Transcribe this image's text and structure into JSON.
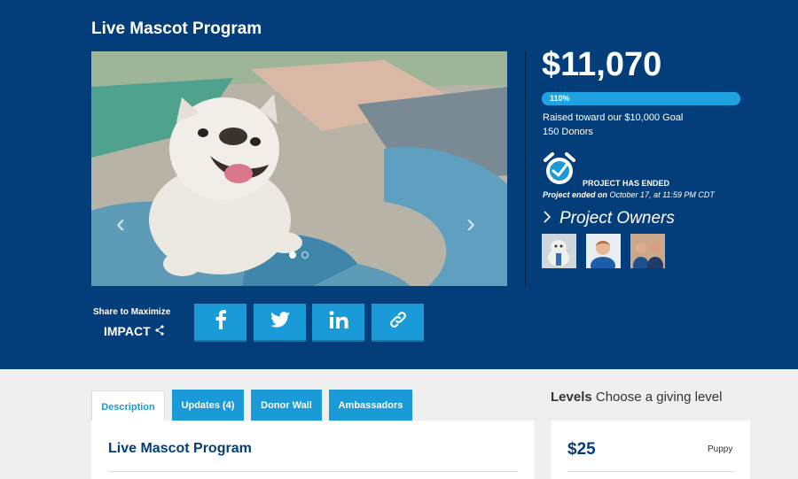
{
  "page": {
    "title": "Live Mascot Program"
  },
  "carousel": {
    "slide_count": 2,
    "active_slide": 1
  },
  "stats": {
    "amount": "$11,070",
    "progress_label": "110%",
    "progress_percent": 110,
    "raised_text": "Raised toward our $10,000 Goal",
    "donors_text": "150 Donors"
  },
  "status": {
    "ended_title": "PROJECT HAS ENDED",
    "ended_prefix": "Project ended on",
    "ended_date": "October 17, at 11:59 PM CDT"
  },
  "owners": {
    "heading": "Project Owners",
    "items": [
      {
        "icon": "owner-photo-bulldog"
      },
      {
        "icon": "owner-photo-woman"
      },
      {
        "icon": "owner-photo-couple"
      }
    ]
  },
  "share": {
    "label": "Share to Maximize",
    "impact": "IMPACT",
    "buttons": [
      {
        "icon": "facebook-icon"
      },
      {
        "icon": "twitter-icon"
      },
      {
        "icon": "linkedin-icon"
      },
      {
        "icon": "link-icon"
      }
    ]
  },
  "tabs": [
    {
      "label": "Description",
      "active": true
    },
    {
      "label": "Updates (4)",
      "active": false
    },
    {
      "label": "Donor Wall",
      "active": false
    },
    {
      "label": "Ambassadors",
      "active": false
    }
  ],
  "description": {
    "title": "Live Mascot Program"
  },
  "levels": {
    "heading_bold": "Levels",
    "heading_rest": "Choose a giving level",
    "items": [
      {
        "amount": "$25",
        "name": "Puppy"
      }
    ]
  },
  "colors": {
    "brand_navy": "#033e7a",
    "accent_blue": "#1a9ad6",
    "page_bg": "#efefef"
  }
}
